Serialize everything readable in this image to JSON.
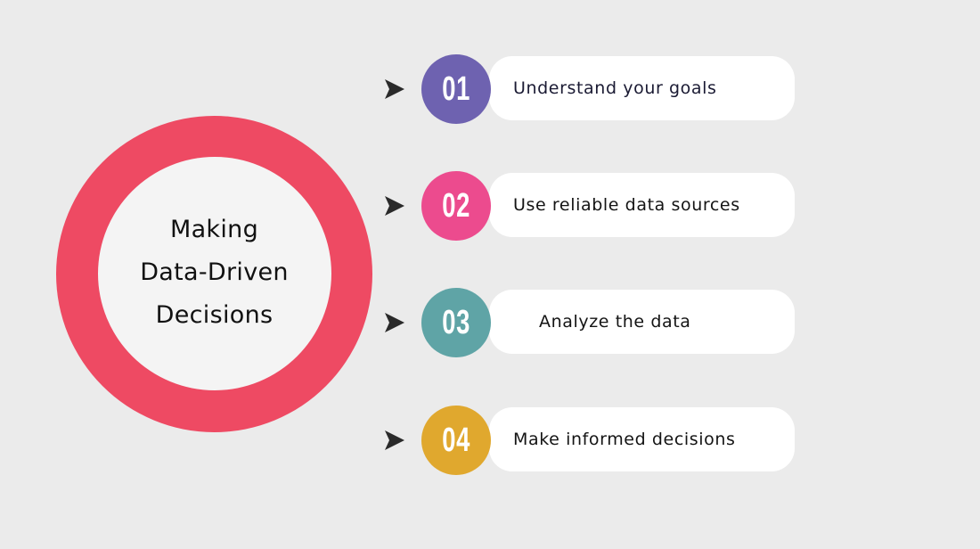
{
  "center": {
    "title_lines": [
      "Making",
      "Data-Driven",
      "Decisions"
    ],
    "ring_color": "#ee4a63",
    "fill_color": "#f4f4f4"
  },
  "steps": [
    {
      "number": "01",
      "label": "Understand your goals",
      "color": "#6e62b0",
      "icon": "arrowhead-icon"
    },
    {
      "number": "02",
      "label": "Use reliable data sources",
      "color": "#ec4b8e",
      "icon": "arrowhead-icon"
    },
    {
      "number": "03",
      "label": "Analyze the data",
      "color": "#5fa4a6",
      "icon": "arrowhead-icon"
    },
    {
      "number": "04",
      "label": "Make informed decisions",
      "color": "#e0a82e",
      "icon": "arrowhead-icon"
    }
  ]
}
